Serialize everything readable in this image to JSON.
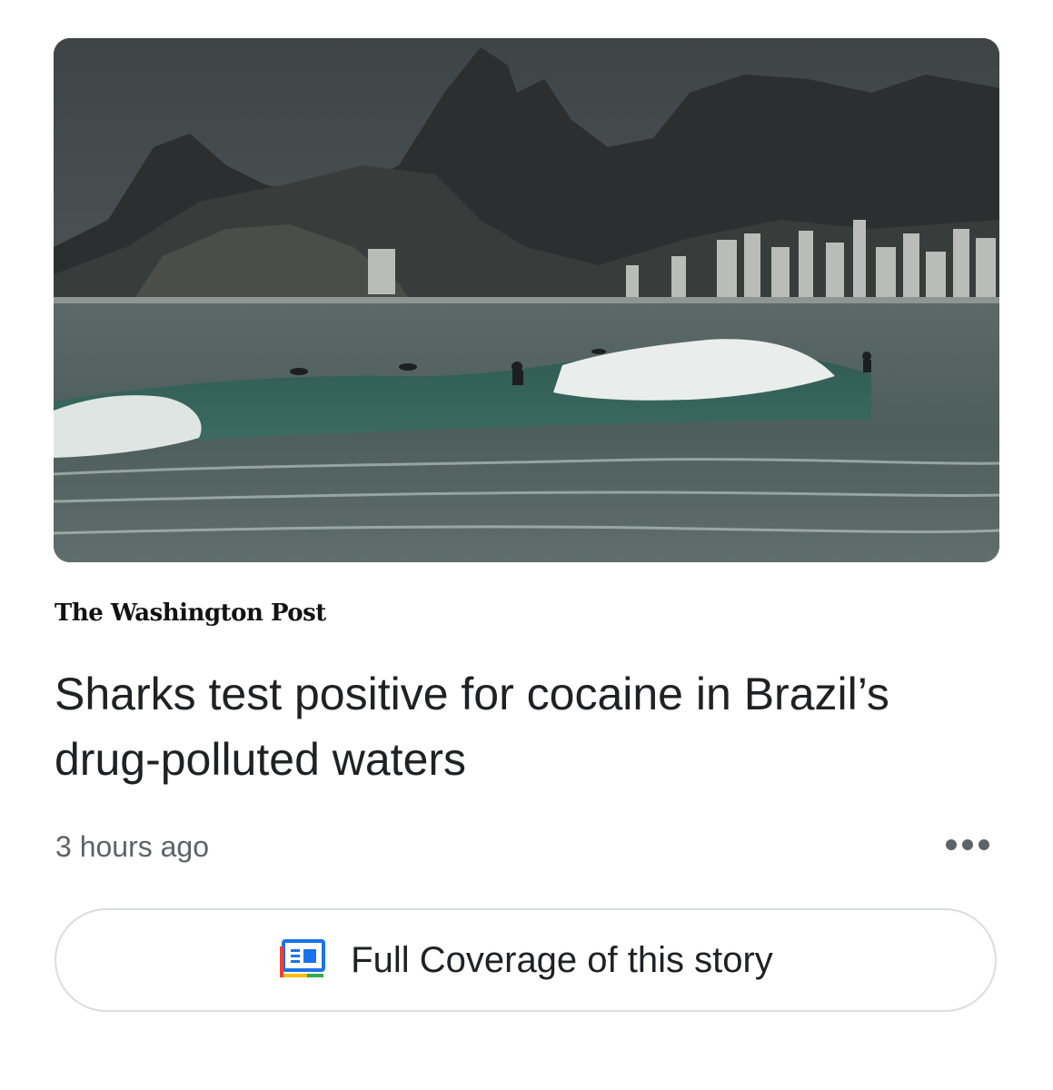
{
  "article": {
    "image_alt": "Surfer on a wave at a beach with mountains and city buildings in the background",
    "publisher": "The Washington Post",
    "headline": "Sharks test positive for cocaine in Brazil’s drug-polluted waters",
    "timestamp": "3 hours ago"
  },
  "actions": {
    "more_icon": "more-horizontal-icon",
    "full_coverage_label": "Full Coverage of this story",
    "full_coverage_icon": "full-coverage-icon"
  },
  "colors": {
    "headline": "#202124",
    "secondary_text": "#5f6368",
    "button_border": "#dadce0",
    "icon_blue": "#1a73e8",
    "icon_red": "#ea4335",
    "icon_yellow": "#fbbc04",
    "icon_green": "#34a853"
  }
}
